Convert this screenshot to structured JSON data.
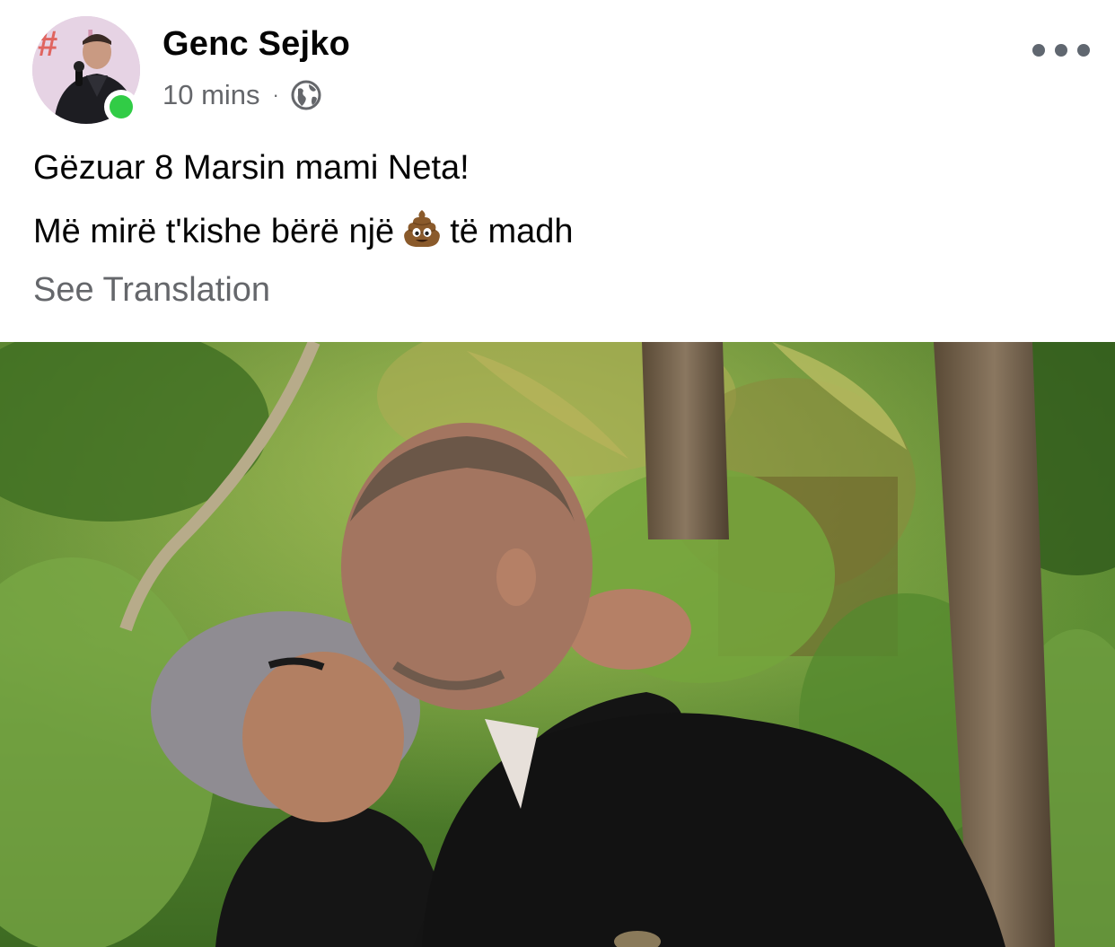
{
  "post": {
    "author": "Genc Sejko",
    "time": "10 mins",
    "separator": "·",
    "privacy_icon": "globe-icon",
    "avatar_text": "#",
    "online_status_color": "#31cc46",
    "text_line1": "Gëzuar 8 Marsin mami Neta!",
    "text_line2_before": "Më mirë t'kishe bërë një",
    "text_emoji": "pile-of-poo-icon",
    "text_line2_after": "të madh",
    "see_translation": "See Translation",
    "more_icon": "more-options-icon",
    "photo": "photo of two people embracing in a garden"
  },
  "colors": {
    "primary_text": "#050505",
    "secondary_text": "#65676b",
    "online": "#31cc46",
    "background": "#ffffff"
  }
}
